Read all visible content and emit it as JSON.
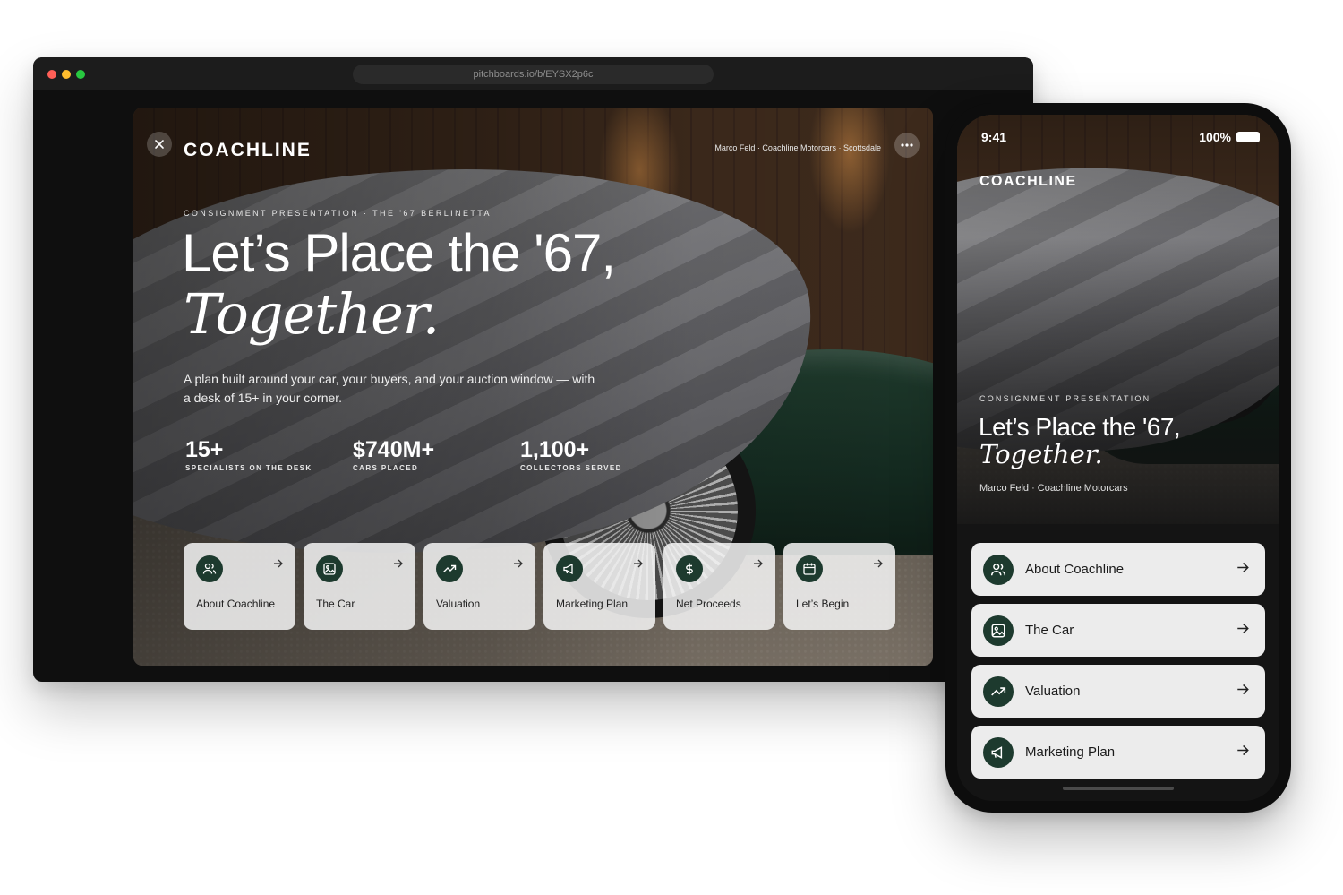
{
  "browser": {
    "url": "pitchboards.io/b/EYSX2p6c"
  },
  "desktop": {
    "brand": "COACHLINE",
    "byline": "Marco Feld · Coachline Motorcars · Scottsdale",
    "eyebrow": "CONSIGNMENT PRESENTATION · THE '67 BERLINETTA",
    "headline": "Let’s Place the '67,",
    "headline_italic": "Together.",
    "tagline": "A plan built around your car, your buyers, and your auction window — with a desk of 15+ in your corner.",
    "stats": [
      {
        "value": "15+",
        "label": "SPECIALISTS ON THE DESK"
      },
      {
        "value": "$740M+",
        "label": "CARS PLACED"
      },
      {
        "value": "1,100+",
        "label": "COLLECTORS SERVED"
      }
    ],
    "cards": [
      {
        "label": "About Coachline",
        "icon": "users-icon"
      },
      {
        "label": "The Car",
        "icon": "image-icon"
      },
      {
        "label": "Valuation",
        "icon": "trending-up-icon"
      },
      {
        "label": "Marketing Plan",
        "icon": "megaphone-icon"
      },
      {
        "label": "Net Proceeds",
        "icon": "dollar-icon"
      },
      {
        "label": "Let’s Begin",
        "icon": "calendar-icon"
      }
    ]
  },
  "phone": {
    "time": "9:41",
    "battery": "100%",
    "brand": "COACHLINE",
    "eyebrow": "CONSIGNMENT PRESENTATION",
    "headline": "Let’s Place the '67,",
    "headline_italic": "Together.",
    "byline": "Marco Feld · Coachline Motorcars",
    "items": [
      {
        "label": "About Coachline",
        "icon": "users-icon"
      },
      {
        "label": "The Car",
        "icon": "image-icon"
      },
      {
        "label": "Valuation",
        "icon": "trending-up-icon"
      },
      {
        "label": "Marketing Plan",
        "icon": "megaphone-icon"
      }
    ]
  },
  "colors": {
    "accent": "#1d3a2e",
    "card_bg": "#f5f5f5",
    "window_dark": "#0f0f0f"
  }
}
